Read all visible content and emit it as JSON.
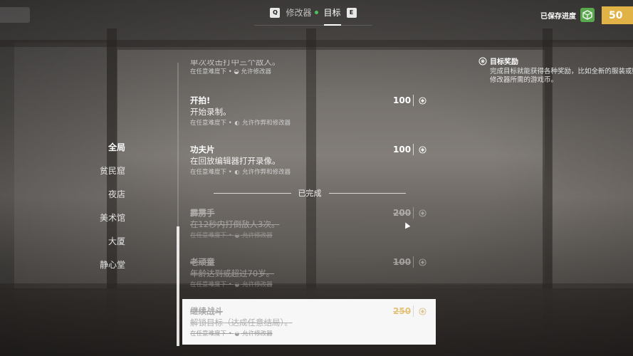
{
  "topbar": {
    "key_left": "Q",
    "tab_modifiers": "修改器",
    "tab_goals": "目标",
    "key_right": "E",
    "saved_text": "已保存进度",
    "coins": "50"
  },
  "nav": {
    "items": [
      "全局",
      "贫民窟",
      "夜店",
      "美术馆",
      "大厦",
      "静心堂"
    ],
    "active_index": 0
  },
  "partial_item": {
    "desc": "单次攻击打中三个敌人。",
    "meta_difficulty": "在任意难度下 •",
    "meta_rule": "允许修改器"
  },
  "goals_active": [
    {
      "title": "开拍!",
      "desc": "开始录制。",
      "meta_difficulty": "在任意难度下 •",
      "meta_rule": "允许作弊和修改器",
      "reward": "100"
    },
    {
      "title": "功夫片",
      "desc": "在回放编辑器打开录像。",
      "meta_difficulty": "在任意难度下 •",
      "meta_rule": "允许作弊和修改器",
      "reward": "100"
    }
  ],
  "completed_label": "已完成",
  "goals_completed": [
    {
      "title": "霹雳手",
      "desc": "在12秒内打倒敌人3次。",
      "meta_difficulty": "在任意难度下 •",
      "meta_rule": "允许修改器",
      "reward": "200"
    },
    {
      "title": "老顽童",
      "desc": "年龄达到或超过70岁。",
      "meta_difficulty": "在任意难度下 •",
      "meta_rule": "允许修改器",
      "reward": "100"
    },
    {
      "title": "继续战斗",
      "desc": "解锁目标（达成任意结局）。",
      "meta_difficulty": "在任意难度下 •",
      "meta_rule": "允许修改器",
      "reward": "250"
    }
  ],
  "info": {
    "title": "目标奖励",
    "body": "完成目标就能获得各种奖励，比如全新的服装或购买修改器所需的游戏币。"
  },
  "colors": {
    "accent_gold": "#e1b347",
    "online_green": "#4cc35a",
    "dice_green": "#5aa84d"
  },
  "icons": [
    "dice-icon",
    "coin-icon",
    "reward-medal-icon",
    "modifier-icon",
    "cheat-icon"
  ]
}
